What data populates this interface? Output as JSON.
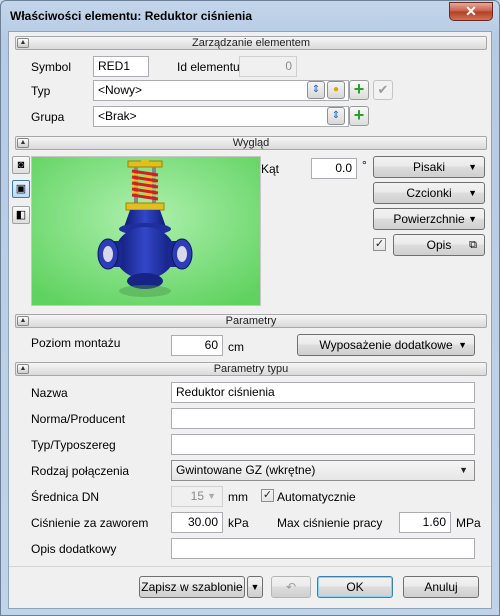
{
  "window": {
    "title": "Właściwości elementu: Reduktor ciśnienia",
    "close_glyph": "✕"
  },
  "section_management": {
    "title": "Zarządzanie elementem",
    "symbol_label": "Symbol",
    "symbol_value": "RED1",
    "id_label": "Id elementu",
    "id_value": "0",
    "type_label": "Typ",
    "type_value": "<Nowy>",
    "group_label": "Grupa",
    "group_value": "<Brak>"
  },
  "section_appearance": {
    "title": "Wygląd",
    "angle_label": "Kąt",
    "angle_value": "0.0",
    "angle_unit": "°",
    "pens_label": "Pisaki",
    "fonts_label": "Czcionki",
    "surfaces_label": "Powierzchnie",
    "description_label": "Opis",
    "description_checked": true,
    "preview_bg": "#7be07b"
  },
  "section_params": {
    "title": "Parametry",
    "mount_label": "Poziom montażu",
    "mount_value": "60",
    "mount_unit": "cm",
    "extra_equipment_label": "Wyposażenie dodatkowe"
  },
  "section_type_params": {
    "title": "Parametry typu",
    "name_label": "Nazwa",
    "name_value": "Reduktor ciśnienia",
    "norm_label": "Norma/Producent",
    "norm_value": "",
    "series_label": "Typ/Typoszereg",
    "series_value": "",
    "connection_label": "Rodzaj połączenia",
    "connection_value": "Gwintowane GZ (wkrętne)",
    "dn_label": "Średnica DN",
    "dn_value": "15",
    "dn_unit": "mm",
    "auto_label": "Automatycznie",
    "auto_checked": true,
    "pressure_label": "Ciśnienie za zaworem",
    "pressure_value": "30.00",
    "pressure_unit": "kPa",
    "max_pressure_label": "Max ciśnienie pracy",
    "max_pressure_value": "1.60",
    "max_pressure_unit": "MPa",
    "extra_desc_label": "Opis dodatkowy",
    "extra_desc_value": ""
  },
  "footer": {
    "save_template_label": "Zapisz w szablonie",
    "ok_label": "OK",
    "cancel_label": "Anuluj"
  },
  "colors": {
    "accent_green": "#2aa02a",
    "valve_blue": "#1f2fa6",
    "spring_red": "#d02020",
    "spring_yellow": "#e8c020"
  }
}
